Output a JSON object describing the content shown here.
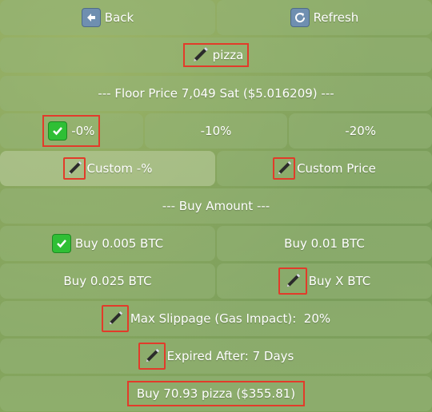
{
  "keyboard": {
    "row1": {
      "back_label": "Back",
      "refresh_label": "Refresh"
    },
    "token_label": "pizza",
    "floor_price_label": "--- Floor Price 7,049 Sat ($5.016209) ---",
    "discount_options": [
      "-0%",
      "-10%",
      "-20%"
    ],
    "custom_percent_label": "Custom -%",
    "custom_price_label": "Custom Price",
    "buy_amount_header": "--- Buy Amount ---",
    "buy_options": [
      "Buy 0.005 BTC",
      "Buy 0.01 BTC",
      "Buy 0.025 BTC",
      "Buy X BTC"
    ],
    "max_slippage_label": "Max Slippage (Gas Impact):  20%",
    "expired_after_label": "Expired After: 7 Days",
    "confirm_buy_label": "Buy 70.93 pizza ($355.81)"
  },
  "colors": {
    "background": "#7f9f5a",
    "button": "#96b478",
    "highlight_border": "#e23b2a",
    "check_green": "#2fbf35"
  }
}
